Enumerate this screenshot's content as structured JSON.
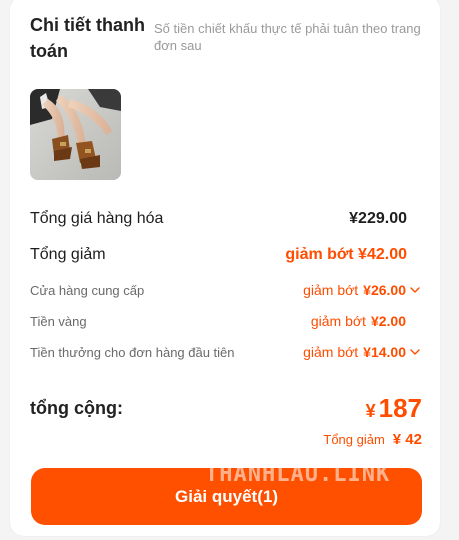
{
  "header": {
    "title": "Chi tiết thanh toán",
    "subtitle": "Số tiền chiết khấu thực tế phải tuân theo trang đơn sau"
  },
  "product": {
    "image_icon": "sandal-product-photo"
  },
  "summary": {
    "goods_total_label": "Tổng giá hàng hóa",
    "goods_total_value": "¥229.00",
    "total_discount_label": "Tổng giảm",
    "total_discount_value": "giảm bớt ¥42.00",
    "items": [
      {
        "label": "Cửa hàng cung cấp",
        "prefix": "giảm bớt",
        "amount": "¥26.00",
        "has_chevron": true
      },
      {
        "label": "Tiền vàng",
        "prefix": "giảm bớt",
        "amount": "¥2.00",
        "has_chevron": false
      },
      {
        "label": "Tiền thưởng cho đơn hàng đầu tiên",
        "prefix": "giảm bớt",
        "amount": "¥14.00",
        "has_chevron": true
      }
    ]
  },
  "total": {
    "label": "tổng cộng:",
    "currency": "¥",
    "value": "187",
    "saving_label": "Tổng giảm",
    "saving_value": "¥ 42"
  },
  "watermark": "THANHLAU.LINK",
  "action": {
    "button_label": "Giải quyết(1)"
  },
  "colors": {
    "accent": "#ff5000",
    "discount_text": "#ff4d00"
  }
}
